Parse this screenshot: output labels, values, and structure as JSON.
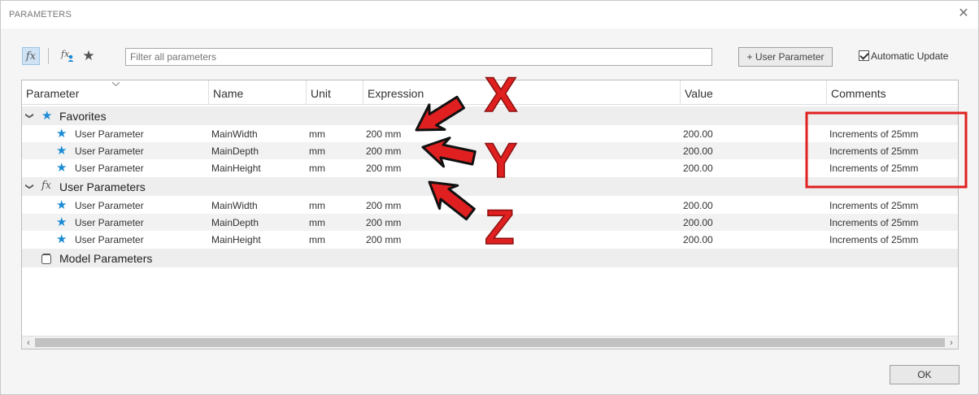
{
  "window": {
    "title": "PARAMETERS"
  },
  "toolbar": {
    "filter_placeholder": "Filter all parameters",
    "user_param_label": "User Parameter",
    "auto_update_label": "Automatic Update",
    "auto_update_checked": true
  },
  "columns": [
    "Parameter",
    "Name",
    "Unit",
    "Expression",
    "Value",
    "Comments"
  ],
  "groups": {
    "favorites": "Favorites",
    "user_params": "User Parameters",
    "model_params": "Model Parameters"
  },
  "favorites_rows": [
    {
      "param": "User Parameter",
      "name": "MainWidth",
      "unit": "mm",
      "expr": "200 mm",
      "value": "200.00",
      "comment": "Increments of 25mm"
    },
    {
      "param": "User Parameter",
      "name": "MainDepth",
      "unit": "mm",
      "expr": "200 mm",
      "value": "200.00",
      "comment": "Increments of 25mm"
    },
    {
      "param": "User Parameter",
      "name": "MainHeight",
      "unit": "mm",
      "expr": "200 mm",
      "value": "200.00",
      "comment": "Increments of 25mm"
    }
  ],
  "user_rows": [
    {
      "param": "User Parameter",
      "name": "MainWidth",
      "unit": "mm",
      "expr": "200 mm",
      "value": "200.00",
      "comment": "Increments of 25mm"
    },
    {
      "param": "User Parameter",
      "name": "MainDepth",
      "unit": "mm",
      "expr": "200 mm",
      "value": "200.00",
      "comment": "Increments of 25mm"
    },
    {
      "param": "User Parameter",
      "name": "MainHeight",
      "unit": "mm",
      "expr": "200 mm",
      "value": "200.00",
      "comment": "Increments of 25mm"
    }
  ],
  "annotations": {
    "x": "X",
    "y": "Y",
    "z": "Z"
  },
  "footer": {
    "ok_label": "OK"
  },
  "colors": {
    "star": "#1a8bd4",
    "annotation": "#e02020"
  }
}
